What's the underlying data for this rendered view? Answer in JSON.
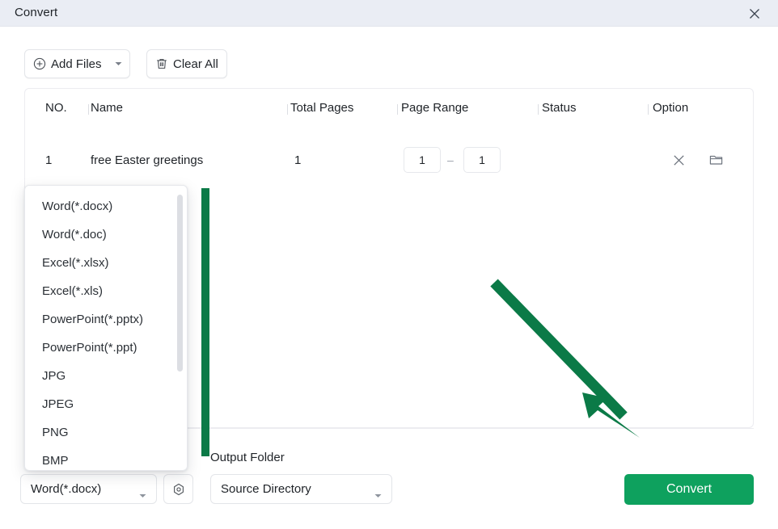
{
  "window": {
    "title": "Convert",
    "close_icon": "close-icon"
  },
  "toolbar": {
    "add_files_label": "Add Files",
    "add_files_icon": "plus-circle-icon",
    "add_files_caret_icon": "chevron-down-icon",
    "clear_all_label": "Clear All",
    "clear_all_icon": "trash-icon"
  },
  "file_table": {
    "columns": [
      {
        "key": "no",
        "label": "NO."
      },
      {
        "key": "name",
        "label": "Name"
      },
      {
        "key": "total_pages",
        "label": "Total Pages"
      },
      {
        "key": "page_range",
        "label": "Page Range"
      },
      {
        "key": "status",
        "label": "Status"
      },
      {
        "key": "option",
        "label": "Option"
      }
    ],
    "rows": [
      {
        "no": "1",
        "name": "free Easter greetings",
        "total_pages": "1",
        "page_range_from": "1",
        "page_range_to": "1",
        "range_separator": "–",
        "status": "",
        "remove_icon": "close-icon",
        "folder_icon": "folder-icon"
      }
    ]
  },
  "format_dropdown": {
    "selected": "Word(*.docx)",
    "caret_icon": "chevron-down-icon",
    "open": true,
    "options": [
      "Word(*.docx)",
      "Word(*.doc)",
      "Excel(*.xlsx)",
      "Excel(*.xls)",
      "PowerPoint(*.pptx)",
      "PowerPoint(*.ppt)",
      "JPG",
      "JPEG",
      "PNG",
      "BMP"
    ]
  },
  "settings_button": {
    "icon": "hex-gear-icon"
  },
  "output": {
    "label": "Output Folder",
    "selected": "Source Directory",
    "caret_icon": "chevron-down-icon"
  },
  "convert_button": {
    "label": "Convert"
  },
  "annotations": {
    "arrow_icon": "arrow-down-right-icon",
    "highlight_bar": "vertical-highlight-bar",
    "accent_color": "#0b7a47",
    "button_color": "#0ea15e"
  }
}
